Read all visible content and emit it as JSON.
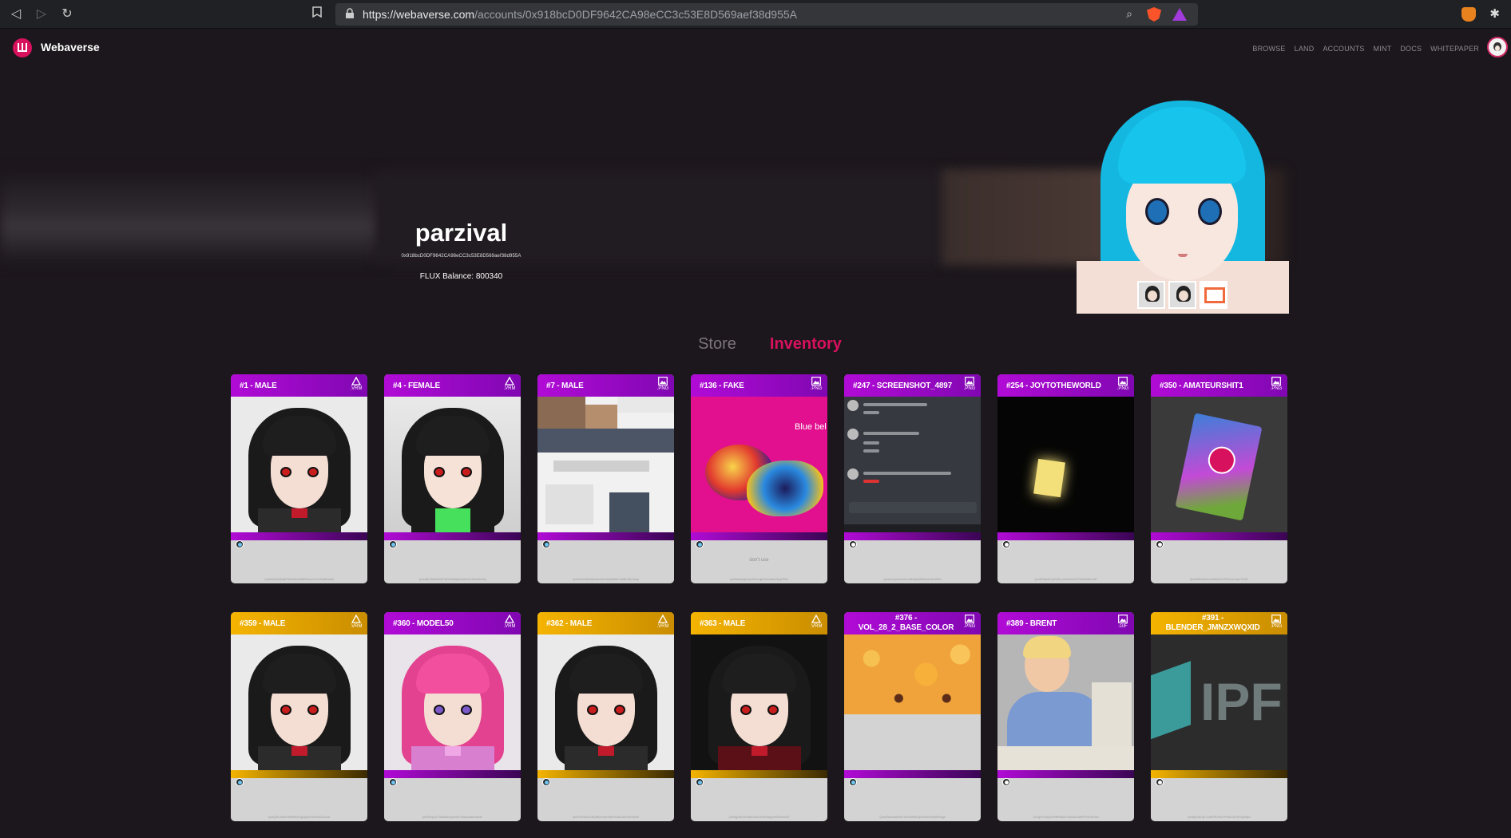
{
  "browser": {
    "url_host": "https://webaverse.com",
    "url_path": "/accounts/0x918bcD0DF9642CA98eCC3c53E8D569aef38d955A"
  },
  "header": {
    "brand": "Webaverse",
    "nav": [
      "BROWSE",
      "LAND",
      "ACCOUNTS",
      "MINT",
      "DOCS",
      "WHITEPAPER"
    ]
  },
  "profile": {
    "name": "parzival",
    "address": "0x918bcD0DF9642CA98eCC3c53E8D569aef38d955A",
    "balance": "FLUX Balance: 800340"
  },
  "tabs": {
    "store": "Store",
    "inventory": "Inventory"
  },
  "cards": [
    {
      "title": "#1 - MALE",
      "ext": ".VRM",
      "theme": "purple",
      "art": "male",
      "desc": "",
      "hash": "QmeNKjW4aM6yPRb54hKr4tdHEDbvzcx7K4H5uBeuAb6"
    },
    {
      "title": "#4 - FEMALE",
      "ext": ".VRM",
      "theme": "purple",
      "art": "female",
      "desc": "",
      "hash": "QmbqB1hNef4e9dP7bE3fm6RjZjmkdbeVh1t1kdDB3Zdj"
    },
    {
      "title": "#7 - MALE",
      "ext": ".PNG",
      "theme": "purple",
      "art": "skin",
      "desc": "",
      "hash": "QmaV8w4b5hxWmdkmHrwHybNkM4rV4k6fHJ3j7Qcdp"
    },
    {
      "title": "#136 - FAKE",
      "ext": ".PNG",
      "theme": "purple",
      "art": "fake",
      "desc": "don't use",
      "hash": "QmRsfwbpdyUwh4HNrvqjN9nKmdtwCfrsgP9f3h"
    },
    {
      "title": "#247 - SCREENSHOT_4897",
      "ext": ".PNG",
      "theme": "purple",
      "art": "shot",
      "desc": "",
      "hash": "QmbxcsJpu4muSLmbdhnjdjuMBhnhdwHxdZ5m"
    },
    {
      "title": "#254 - JOYTOTHEWORLD",
      "ext": ".PNG",
      "theme": "purple",
      "art": "night",
      "desc": "",
      "hash": "QmSRNwhkV2yPsRvLmzhkrDa4xFF9HR6dtorLhdP"
    },
    {
      "title": "#350 - AMATEURSHIT1",
      "ext": ".PNG",
      "theme": "purple",
      "art": "pack",
      "desc": "",
      "hash": "QmM4WnsfGesXxMNd1kuSPbXnZw1opn7FoN7"
    },
    {
      "title": "#359 - MALE",
      "ext": ".VRM",
      "theme": "gold",
      "art": "male",
      "desc": "",
      "hash": "QmbQRvJw5kVhRf3iW2xrQpqMyVhuPvcWJXdwdx"
    },
    {
      "title": "#360 - MODEL50",
      "ext": ".VRM",
      "theme": "purple",
      "art": "pink",
      "desc": "",
      "hash": "QmRNvpxxC7d6dbEbmpb4vkPJnwkp5dsRvrabdF"
    },
    {
      "title": "#362 - MALE",
      "ext": ".VRM",
      "theme": "gold",
      "art": "male",
      "desc": "",
      "hash": "QmPG2H4bxZcRQ8NnmmxPwfWYKb6CwFKdbXBrWe"
    },
    {
      "title": "#363 - MALE",
      "ext": ".VRM",
      "theme": "gold",
      "art": "maledark",
      "desc": "",
      "hash": "Qm9xgXfdrs9mh5bUxWLbUhPfwqqXeRZRbdnbJF"
    },
    {
      "title": "#376 - VOL_28_2_BASE_COLOR",
      "ext": ".PNG",
      "theme": "purple",
      "art": "pasta",
      "desc": "",
      "hash": "QmzvR6xsbbaSb9TZEmWRMcQmZfacMmRyREbmgk"
    },
    {
      "title": "#389 - BRENT",
      "ext": ".GIF",
      "theme": "purple",
      "art": "office",
      "desc": "",
      "hash": "QmQpFKGdybuPhBRNaUEXdrAuM7aeRPYcrEfsVWb"
    },
    {
      "title": "#391 - BLENDER_JMNZXWQXID",
      "ext": ".PNG",
      "theme": "gold",
      "art": "ipfs",
      "desc": "",
      "hash": "QmWjnXabJpT1m4fPRLPhfcFPHzbCdsTEPQx6Npn"
    }
  ]
}
